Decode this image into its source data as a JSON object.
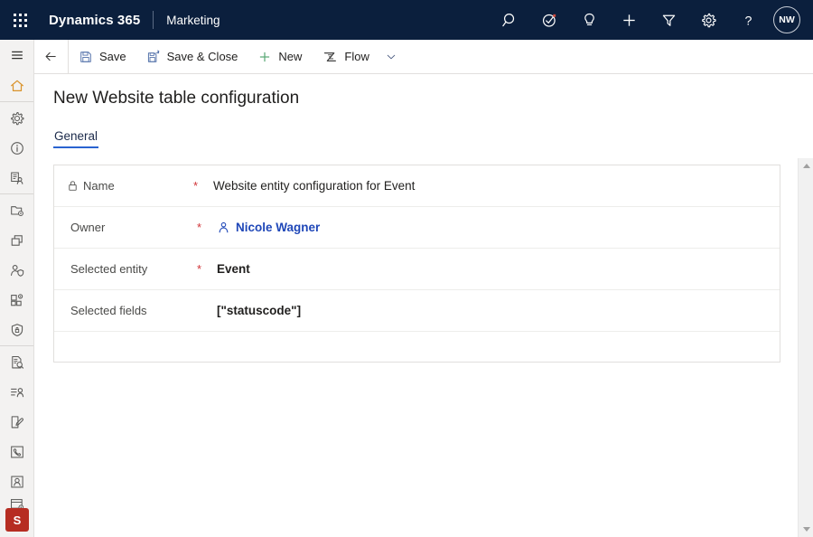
{
  "topbar": {
    "waffle_label": "App launcher",
    "brand": "Dynamics 365",
    "app_name": "Marketing",
    "background_color": "#0b1f3d",
    "icons": [
      {
        "name": "search-icon",
        "label": "Search"
      },
      {
        "name": "assistant-icon",
        "label": "Relationship assistant"
      },
      {
        "name": "lightbulb-icon",
        "label": "Insights"
      },
      {
        "name": "add-icon",
        "label": "Quick create"
      },
      {
        "name": "filter-icon",
        "label": "Filter"
      },
      {
        "name": "gear-icon",
        "label": "Settings"
      },
      {
        "name": "help-icon",
        "label": "Help"
      }
    ],
    "avatar_initials": "NW"
  },
  "rail": {
    "items": [
      {
        "name": "hamburger-menu-icon",
        "label": "Site map"
      },
      {
        "name": "home-icon",
        "label": "Home"
      },
      {
        "name": "gear-icon",
        "label": "Settings"
      },
      {
        "name": "info-icon",
        "label": "Information"
      },
      {
        "name": "contact-list-icon",
        "label": "Contacts"
      },
      {
        "name": "folder-settings-icon",
        "label": "Configuration"
      },
      {
        "name": "copy-stack-icon",
        "label": "Templates"
      },
      {
        "name": "person-shield-icon",
        "label": "Consent"
      },
      {
        "name": "apps-settings-icon",
        "label": "Integrations"
      },
      {
        "name": "shield-lock-icon",
        "label": "Compliance"
      },
      {
        "name": "document-search-icon",
        "label": "Audit"
      },
      {
        "name": "list-person-icon",
        "label": "Segments"
      },
      {
        "name": "page-edit-icon",
        "label": "Forms"
      },
      {
        "name": "phone-icon",
        "label": "Phone"
      },
      {
        "name": "person-badge-icon",
        "label": "Accounts"
      },
      {
        "name": "card-settings-icon",
        "label": "Cards"
      }
    ],
    "badge_label": "S",
    "badge_color": "#b62d22"
  },
  "commandbar": {
    "back_label": "Back",
    "buttons": [
      {
        "name": "save-button",
        "label": "Save",
        "icon": "save-icon"
      },
      {
        "name": "save-and-close-button",
        "label": "Save & Close",
        "icon": "save-close-icon"
      },
      {
        "name": "new-button",
        "label": "New",
        "icon": "plus-icon"
      },
      {
        "name": "flow-button",
        "label": "Flow",
        "icon": "flow-icon"
      }
    ],
    "overflow_label": "More commands"
  },
  "main": {
    "page_title": "New Website table configuration",
    "tabs": [
      {
        "name": "tab-general",
        "label": "General",
        "active": true
      }
    ],
    "accent_color": "#2a63d0",
    "required_color": "#d13438",
    "form": {
      "rows": [
        {
          "name": "field-name",
          "label": "Name",
          "required": true,
          "locked": true,
          "value": "Website entity configuration for Event",
          "value_style": "plain"
        },
        {
          "name": "field-owner",
          "label": "Owner",
          "required": true,
          "locked": false,
          "value": "Nicole Wagner",
          "value_style": "link"
        },
        {
          "name": "field-selected-entity",
          "label": "Selected entity",
          "required": true,
          "locked": false,
          "value": "Event",
          "value_style": "bold"
        },
        {
          "name": "field-selected-fields",
          "label": "Selected fields",
          "required": false,
          "locked": false,
          "value": "[\"statuscode\"]",
          "value_style": "bold"
        }
      ],
      "required_marker": "*"
    }
  },
  "scrollbar": {
    "up_label": "Scroll up",
    "down_label": "Scroll down"
  }
}
